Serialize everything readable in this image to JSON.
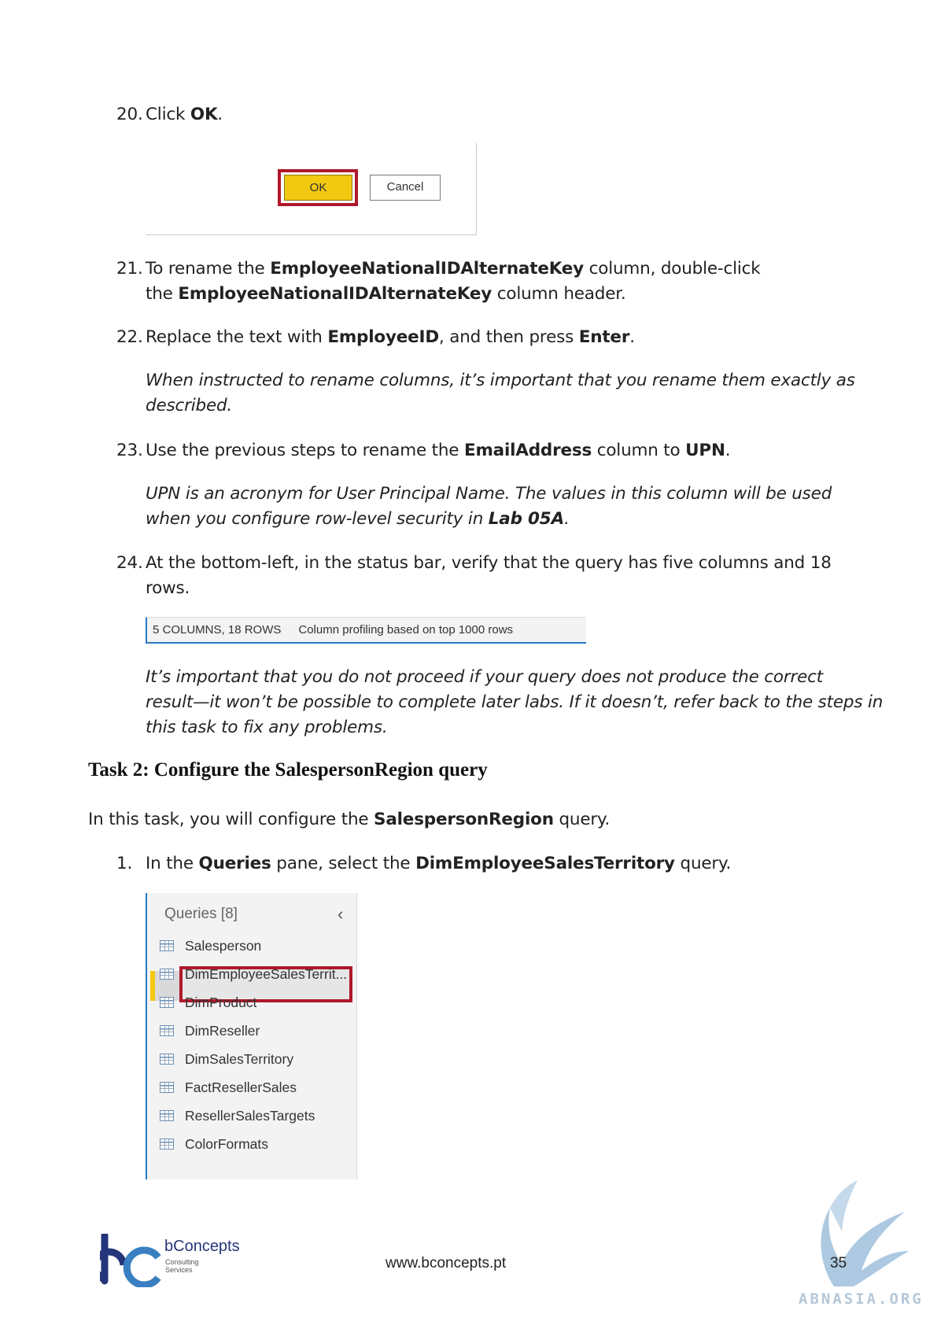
{
  "steps": {
    "s20": {
      "num": "20.",
      "pre": "Click ",
      "b1": "OK",
      "post": "."
    },
    "dialog": {
      "ok_label": "OK",
      "cancel_label": "Cancel"
    },
    "s21": {
      "num": "21.",
      "l1_pre": "To rename the ",
      "l1_b": "EmployeeNationalIDAlternateKey",
      "l1_post": " column, double-click",
      "l2_pre": "the ",
      "l2_b": "EmployeeNationalIDAlternateKey",
      "l2_post": " column header."
    },
    "s22": {
      "num": "22.",
      "pre": "Replace the text with ",
      "b1": "EmployeeID",
      "mid": ", and then press ",
      "b2": "Enter",
      "post": "."
    },
    "note22": {
      "l1": "When instructed to rename columns, it’s important that you rename them exactly as",
      "l2": "described."
    },
    "s23": {
      "num": "23.",
      "pre": "Use the previous steps to rename the ",
      "b1": "EmailAddress",
      "mid": " column to ",
      "b2": "UPN",
      "post": "."
    },
    "note23": {
      "l1": "UPN is an acronym for User Principal Name. The values in this column will be used",
      "l2_pre": "when you configure row-level security in ",
      "l2_b": "Lab 05A",
      "l2_post": "."
    },
    "s24": {
      "num": "24.",
      "l1": "At the bottom-left, in the status bar, verify that the query has five columns and 18",
      "l2": "rows."
    },
    "status_bar": {
      "counts": "5 COLUMNS, 18 ROWS",
      "profiling": "Column profiling based on top 1000 rows"
    },
    "note24": {
      "l1": "It’s important that you do not proceed if your query does not produce the correct",
      "l2": "result—it won’t be possible to complete later labs. If it doesn’t, refer back to the steps in",
      "l3": "this task to fix any problems."
    }
  },
  "task2": {
    "heading": "Task 2: Configure the SalespersonRegion query",
    "intro_pre": "In this task, you will configure the ",
    "intro_b": "SalespersonRegion",
    "intro_post": " query.",
    "s1": {
      "num": "1.",
      "pre": "In the ",
      "b1": "Queries",
      "mid": " pane, select the ",
      "b2": "DimEmployeeSalesTerritory",
      "post": " query."
    }
  },
  "queries_pane": {
    "title": "Queries [8]",
    "items": [
      "Salesperson",
      "DimEmployeeSalesTerrit...",
      "DimProduct",
      "DimReseller",
      "DimSalesTerritory",
      "FactResellerSales",
      "ResellerSalesTargets",
      "ColorFormats"
    ],
    "selected_index": 1,
    "icon": "table-icon"
  },
  "footer": {
    "brand": "bConcepts",
    "brand_sub1": "Consulting",
    "brand_sub2": "Services",
    "url": "www.bconcepts.pt",
    "page": "35",
    "watermark": "ABNASIA.ORG"
  },
  "colors": {
    "accent_yellow": "#f2c811",
    "highlight_red": "#b0182b",
    "pbi_blue": "#2b79c2",
    "brand_navy": "#24357a"
  }
}
